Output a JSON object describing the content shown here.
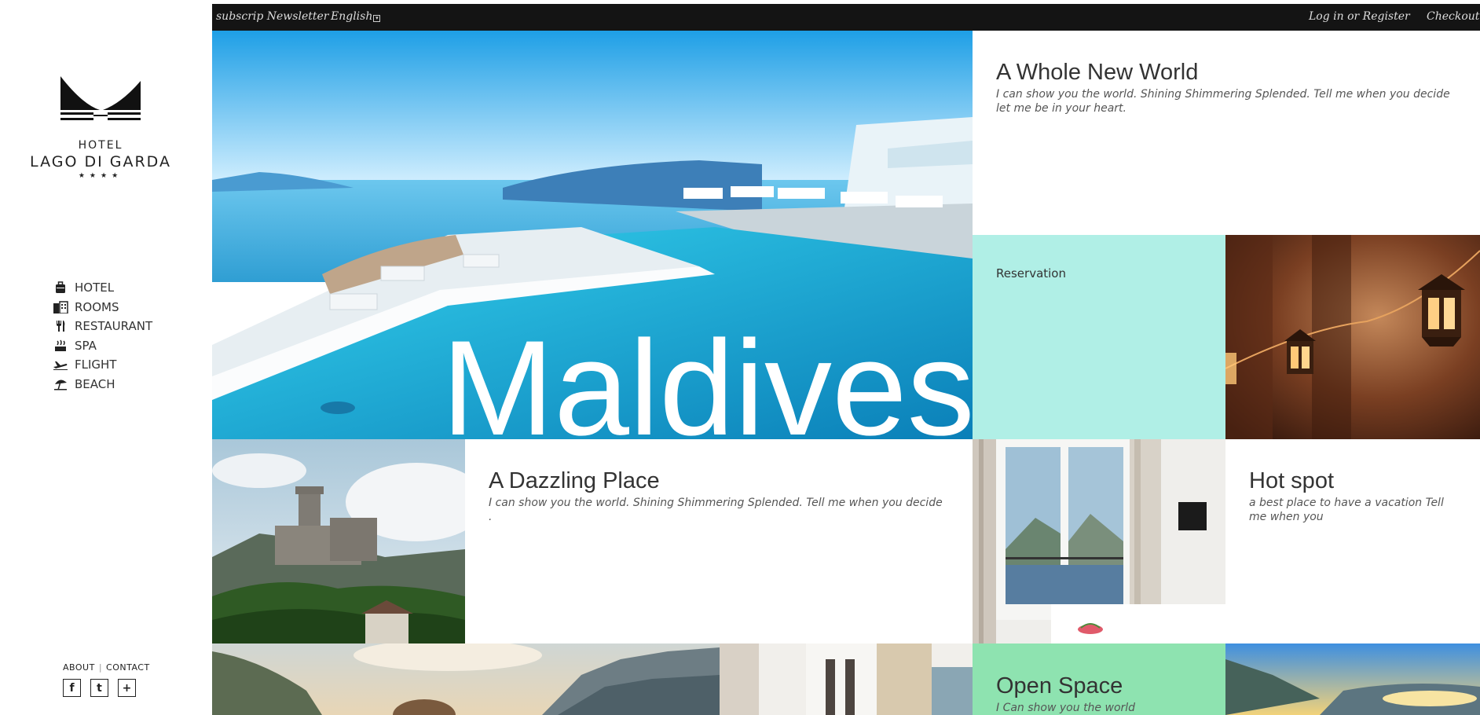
{
  "sidebar": {
    "logo": {
      "hotel": "HOTEL",
      "name": "LAGO DI GARDA",
      "stars": "★★★★"
    },
    "nav": [
      {
        "label": "HOTEL",
        "icon": "suitcase-icon"
      },
      {
        "label": "ROOMS",
        "icon": "building-icon"
      },
      {
        "label": "RESTAURANT",
        "icon": "fork-knife-icon"
      },
      {
        "label": "SPA",
        "icon": "spa-icon"
      },
      {
        "label": "FLIGHT",
        "icon": "airplane-icon"
      },
      {
        "label": "BEACH",
        "icon": "umbrella-icon"
      }
    ],
    "footer": {
      "about": "ABOUT",
      "sep": "|",
      "contact": "CONTACT",
      "social": [
        "f",
        "t",
        "+"
      ]
    }
  },
  "topbar": {
    "newsletter": "subscrip Newsletter",
    "language": "English",
    "login": "Log in or Register",
    "checkout": "Checkout"
  },
  "tiles": {
    "hero_title": "Maldives",
    "whole_new_world": {
      "title": "A Whole New World",
      "text": "I can show you the world. Shining Shimmering Splended. Tell me when you decide let me be in your heart."
    },
    "reservation": "Reservation",
    "dazzling": {
      "title": "A Dazzling Place",
      "text": "I can show you the world. Shining Shimmering Splended. Tell me when you decide ."
    },
    "hotspot": {
      "title": "Hot spot",
      "text": "a best place to have a vacation Tell me when you"
    },
    "open_space": {
      "title": "Open Space",
      "text": "I Can show you the world"
    }
  },
  "colors": {
    "topbar": "#141414",
    "reservation": "#b0efe6",
    "open_space": "#8ee3b0"
  }
}
